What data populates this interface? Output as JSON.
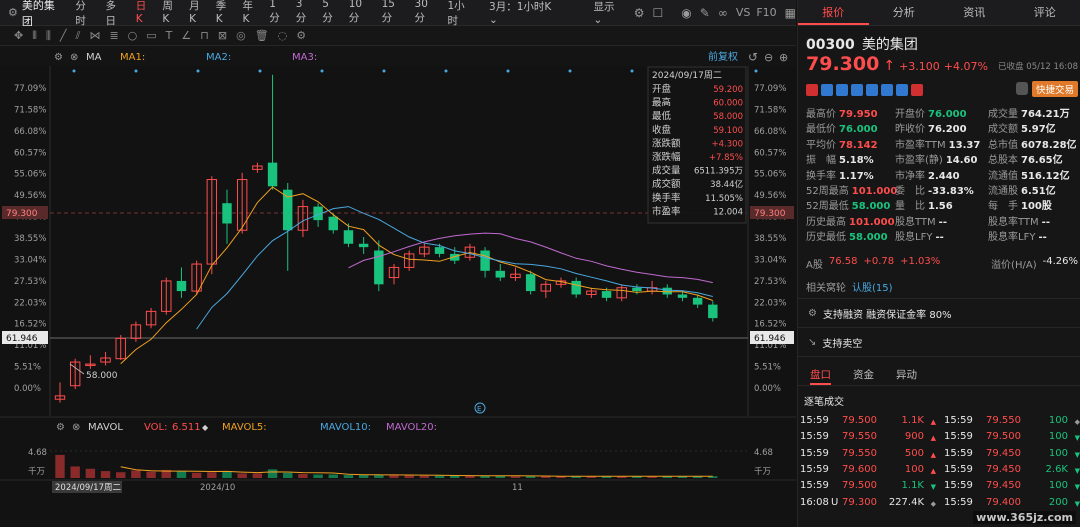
{
  "app": {
    "name": "美的集团",
    "timeframes": [
      {
        "label": "分时",
        "active": false
      },
      {
        "label": "多日",
        "active": false
      },
      {
        "label": "日K",
        "active": true
      },
      {
        "label": "周K",
        "active": false
      },
      {
        "label": "月K",
        "active": false
      },
      {
        "label": "季K",
        "active": false
      },
      {
        "label": "年K",
        "active": false
      },
      {
        "label": "1分",
        "active": false
      },
      {
        "label": "3分",
        "active": false
      },
      {
        "label": "5分",
        "active": false
      },
      {
        "label": "10分",
        "active": false
      },
      {
        "label": "15分",
        "active": false
      },
      {
        "label": "30分",
        "active": false
      },
      {
        "label": "1小时",
        "active": false
      }
    ],
    "range_select": "3月：1小时K",
    "display_label": "显示",
    "vs_label": "VS",
    "f10_label": "F10"
  },
  "chart": {
    "ma_label": "MA",
    "ma1": "MA1:",
    "ma2": "MA2:",
    "ma3": "MA3:",
    "adjust": "前复权",
    "colors": {
      "ma1": "#f0a020",
      "ma2": "#4aa8e0",
      "ma3": "#c06ad0",
      "up": "#ff4d4d",
      "down": "#19c37d"
    },
    "y_ticks": [
      "77.09%",
      "71.58%",
      "66.08%",
      "60.57%",
      "55.06%",
      "49.56%",
      "44.05%",
      "38.55%",
      "33.04%",
      "27.53%",
      "22.03%",
      "16.52%",
      "11.01%",
      "5.51%",
      "0.00%"
    ],
    "price_marker_top": "79.300",
    "price_marker_low": "61.946",
    "low_annotation": "58.000",
    "x_ticks": [
      "2024/09/17周二",
      "2024/10",
      "11"
    ],
    "tooltip": {
      "date": "2024/09/17周二",
      "rows": [
        {
          "label": "开盘",
          "value": "59.200",
          "cls": "up"
        },
        {
          "label": "最高",
          "value": "60.000",
          "cls": "up"
        },
        {
          "label": "最低",
          "value": "58.000",
          "cls": "up"
        },
        {
          "label": "收盘",
          "value": "59.100",
          "cls": "up"
        },
        {
          "label": "涨跌额",
          "value": "+4.300",
          "cls": "up"
        },
        {
          "label": "涨跌幅",
          "value": "+7.85%",
          "cls": "up"
        },
        {
          "label": "成交量",
          "value": "6511.395万",
          "cls": "white"
        },
        {
          "label": "成交额",
          "value": "38.44亿",
          "cls": "white"
        },
        {
          "label": "换手率",
          "value": "11.505%",
          "cls": "white"
        },
        {
          "label": "市盈率",
          "value": "12.004",
          "cls": "white"
        }
      ]
    },
    "vol": {
      "title": "MAVOL",
      "vol_label": "VOL:",
      "vol_value": "6.511",
      "mavol5": "MAVOL5:",
      "mavol10": "MAVOL10:",
      "mavol20": "MAVOL20:",
      "y_top": "4.68",
      "y_unit": "千万"
    }
  },
  "chart_data": {
    "type": "candlestick",
    "series": [
      {
        "o": 53.0,
        "h": 55.5,
        "l": 52.5,
        "c": 53.5
      },
      {
        "o": 55.0,
        "h": 59.0,
        "l": 54.5,
        "c": 58.5
      },
      {
        "o": 58.0,
        "h": 59.5,
        "l": 57.5,
        "c": 58.2
      },
      {
        "o": 58.5,
        "h": 60.0,
        "l": 58.0,
        "c": 59.1
      },
      {
        "o": 59.0,
        "h": 62.5,
        "l": 58.8,
        "c": 62.0
      },
      {
        "o": 62.0,
        "h": 64.5,
        "l": 61.5,
        "c": 64.0
      },
      {
        "o": 64.0,
        "h": 66.5,
        "l": 63.5,
        "c": 66.0
      },
      {
        "o": 66.0,
        "h": 71.0,
        "l": 65.5,
        "c": 70.5
      },
      {
        "o": 70.5,
        "h": 72.5,
        "l": 68.0,
        "c": 69.0
      },
      {
        "o": 69.0,
        "h": 73.5,
        "l": 68.5,
        "c": 73.0
      },
      {
        "o": 73.0,
        "h": 86.0,
        "l": 71.5,
        "c": 85.5
      },
      {
        "o": 82.0,
        "h": 84.0,
        "l": 76.0,
        "c": 79.0
      },
      {
        "o": 78.0,
        "h": 86.5,
        "l": 77.5,
        "c": 85.5
      },
      {
        "o": 87.0,
        "h": 88.0,
        "l": 86.5,
        "c": 87.5
      },
      {
        "o": 88.0,
        "h": 101.0,
        "l": 84.0,
        "c": 84.5
      },
      {
        "o": 84.0,
        "h": 85.0,
        "l": 72.0,
        "c": 78.0
      },
      {
        "o": 78.0,
        "h": 82.5,
        "l": 77.0,
        "c": 81.5
      },
      {
        "o": 81.5,
        "h": 82.0,
        "l": 78.5,
        "c": 79.5
      },
      {
        "o": 80.0,
        "h": 80.5,
        "l": 77.5,
        "c": 78.0
      },
      {
        "o": 78.0,
        "h": 79.0,
        "l": 75.5,
        "c": 76.0
      },
      {
        "o": 76.0,
        "h": 77.0,
        "l": 74.5,
        "c": 75.5
      },
      {
        "o": 75.0,
        "h": 76.5,
        "l": 69.0,
        "c": 70.0
      },
      {
        "o": 71.0,
        "h": 73.0,
        "l": 70.0,
        "c": 72.5
      },
      {
        "o": 72.5,
        "h": 75.0,
        "l": 72.0,
        "c": 74.5
      },
      {
        "o": 74.5,
        "h": 76.0,
        "l": 74.0,
        "c": 75.5
      },
      {
        "o": 75.5,
        "h": 76.0,
        "l": 74.0,
        "c": 74.5
      },
      {
        "o": 74.5,
        "h": 75.5,
        "l": 73.0,
        "c": 73.5
      },
      {
        "o": 74.0,
        "h": 76.0,
        "l": 73.5,
        "c": 75.5
      },
      {
        "o": 75.0,
        "h": 75.5,
        "l": 71.0,
        "c": 72.0
      },
      {
        "o": 72.0,
        "h": 73.0,
        "l": 70.5,
        "c": 71.0
      },
      {
        "o": 71.0,
        "h": 72.5,
        "l": 70.5,
        "c": 71.5
      },
      {
        "o": 71.5,
        "h": 72.0,
        "l": 68.5,
        "c": 69.0
      },
      {
        "o": 69.0,
        "h": 70.5,
        "l": 68.0,
        "c": 70.0
      },
      {
        "o": 70.0,
        "h": 71.0,
        "l": 69.5,
        "c": 70.5
      },
      {
        "o": 70.5,
        "h": 71.0,
        "l": 68.0,
        "c": 68.5
      },
      {
        "o": 68.5,
        "h": 69.5,
        "l": 68.0,
        "c": 69.0
      },
      {
        "o": 69.0,
        "h": 69.5,
        "l": 67.5,
        "c": 68.0
      },
      {
        "o": 68.0,
        "h": 70.0,
        "l": 67.5,
        "c": 69.5
      },
      {
        "o": 69.5,
        "h": 70.0,
        "l": 68.5,
        "c": 69.0
      },
      {
        "o": 69.0,
        "h": 70.5,
        "l": 68.5,
        "c": 69.5
      },
      {
        "o": 69.5,
        "h": 70.0,
        "l": 68.0,
        "c": 68.5
      },
      {
        "o": 68.5,
        "h": 69.0,
        "l": 67.5,
        "c": 68.0
      },
      {
        "o": 68.0,
        "h": 68.5,
        "l": 66.5,
        "c": 67.0
      },
      {
        "o": 67.0,
        "h": 67.5,
        "l": 64.5,
        "c": 65.0
      }
    ],
    "ylim": [
      52,
      102
    ],
    "volumes": [
      4.0,
      2.0,
      1.6,
      1.2,
      1.0,
      1.3,
      1.1,
      1.4,
      1.2,
      0.9,
      1.0,
      1.2,
      0.8,
      0.8,
      1.5,
      0.9,
      0.7,
      0.6,
      0.6,
      0.5,
      0.5,
      0.6,
      0.5,
      0.5,
      0.4,
      0.4,
      0.4,
      0.4,
      0.4,
      0.4,
      0.3,
      0.3,
      0.3,
      0.3,
      0.3,
      0.3,
      0.3,
      0.3,
      0.3,
      0.3,
      0.3,
      0.3,
      0.3,
      0.3
    ],
    "vol_ylim": [
      0,
      4.68
    ]
  },
  "quote": {
    "tabs": [
      {
        "label": "报价",
        "active": true
      },
      {
        "label": "分析",
        "active": false
      },
      {
        "label": "资讯",
        "active": false
      },
      {
        "label": "评论",
        "active": false
      }
    ],
    "code": "00300",
    "name": "美的集团",
    "status": "已收盘 05/12 16:08",
    "price": "79.300",
    "change": "+3.100",
    "change_pct": "+4.07%",
    "quick_trade": "快捷交易",
    "stats": [
      [
        {
          "l": "最高价",
          "v": "79.950",
          "c": "up"
        },
        {
          "l": "开盘价",
          "v": "76.000",
          "c": "down"
        },
        {
          "l": "成交量",
          "v": "764.21万",
          "c": "white"
        }
      ],
      [
        {
          "l": "最低价",
          "v": "76.000",
          "c": "down"
        },
        {
          "l": "昨收价",
          "v": "76.200",
          "c": "white"
        },
        {
          "l": "成交额",
          "v": "5.97亿",
          "c": "white"
        }
      ],
      [
        {
          "l": "平均价",
          "v": "78.142",
          "c": "up"
        },
        {
          "l": "市盈率TTM",
          "v": "13.37",
          "c": "white"
        },
        {
          "l": "总市值",
          "v": "6078.28亿",
          "c": "white"
        }
      ],
      [
        {
          "l": "振　幅",
          "v": "5.18%",
          "c": "white"
        },
        {
          "l": "市盈率(静)",
          "v": "14.60",
          "c": "white"
        },
        {
          "l": "总股本",
          "v": "76.65亿",
          "c": "white"
        }
      ],
      [
        {
          "l": "换手率",
          "v": "1.17%",
          "c": "white"
        },
        {
          "l": "市净率",
          "v": "2.440",
          "c": "white"
        },
        {
          "l": "流通值",
          "v": "516.12亿",
          "c": "white"
        }
      ],
      [
        {
          "l": "52周最高",
          "v": "101.000",
          "c": "up"
        },
        {
          "l": "委　比",
          "v": "-33.83%",
          "c": "white"
        },
        {
          "l": "流通股",
          "v": "6.51亿",
          "c": "white"
        }
      ],
      [
        {
          "l": "52周最低",
          "v": "58.000",
          "c": "down"
        },
        {
          "l": "量　比",
          "v": "1.56",
          "c": "white"
        },
        {
          "l": "每　手",
          "v": "100股",
          "c": "white"
        }
      ],
      [
        {
          "l": "历史最高",
          "v": "101.000",
          "c": "up"
        },
        {
          "l": "股息TTM",
          "v": "--",
          "c": "white"
        },
        {
          "l": "股息率TTM",
          "v": "--",
          "c": "white"
        }
      ],
      [
        {
          "l": "历史最低",
          "v": "58.000",
          "c": "down"
        },
        {
          "l": "股息LFY",
          "v": "--",
          "c": "white"
        },
        {
          "l": "股息率LFY",
          "v": "--",
          "c": "white"
        }
      ]
    ],
    "ashare": {
      "label": "A股",
      "price": "76.58",
      "change": "+0.78",
      "pct": "+1.03%",
      "premium_label": "溢价(H/A)",
      "premium": "-4.26%"
    },
    "warrant": {
      "label": "相关窝轮",
      "value": "认股(15)"
    },
    "margin": "支持融资 融资保证金率 80%",
    "short": "支持卖空",
    "bottom_tabs": [
      {
        "label": "盘口",
        "active": true
      },
      {
        "label": "资金",
        "active": false
      },
      {
        "label": "异动",
        "active": false
      }
    ],
    "trades_title": "逐笔成交",
    "trades_left": [
      {
        "t": "15:59",
        "p": "79.500",
        "v": "1.1K",
        "d": "up",
        "pc": "up",
        "vc": "up"
      },
      {
        "t": "15:59",
        "p": "79.550",
        "v": "900",
        "d": "up",
        "pc": "up",
        "vc": "up"
      },
      {
        "t": "15:59",
        "p": "79.550",
        "v": "500",
        "d": "up",
        "pc": "up",
        "vc": "up"
      },
      {
        "t": "15:59",
        "p": "79.600",
        "v": "100",
        "d": "up",
        "pc": "up",
        "vc": "up"
      },
      {
        "t": "15:59",
        "p": "79.500",
        "v": "1.1K",
        "d": "down",
        "pc": "up",
        "vc": "down"
      },
      {
        "t": "16:08",
        "p": "79.300",
        "v": "227.4K",
        "d": "flat",
        "pc": "up",
        "vc": "white",
        "u": "U"
      }
    ],
    "trades_right": [
      {
        "t": "15:59",
        "p": "79.550",
        "v": "100",
        "d": "flat",
        "pc": "up",
        "vc": "down"
      },
      {
        "t": "15:59",
        "p": "79.500",
        "v": "100",
        "d": "down",
        "pc": "up",
        "vc": "down"
      },
      {
        "t": "15:59",
        "p": "79.450",
        "v": "100",
        "d": "down",
        "pc": "up",
        "vc": "down"
      },
      {
        "t": "15:59",
        "p": "79.450",
        "v": "2.6K",
        "d": "down",
        "pc": "up",
        "vc": "down"
      },
      {
        "t": "15:59",
        "p": "79.450",
        "v": "100",
        "d": "down",
        "pc": "up",
        "vc": "down"
      },
      {
        "t": "15:59",
        "p": "79.400",
        "v": "200",
        "d": "down",
        "pc": "up",
        "vc": "down"
      }
    ],
    "watermark": "www.365jz.com"
  }
}
